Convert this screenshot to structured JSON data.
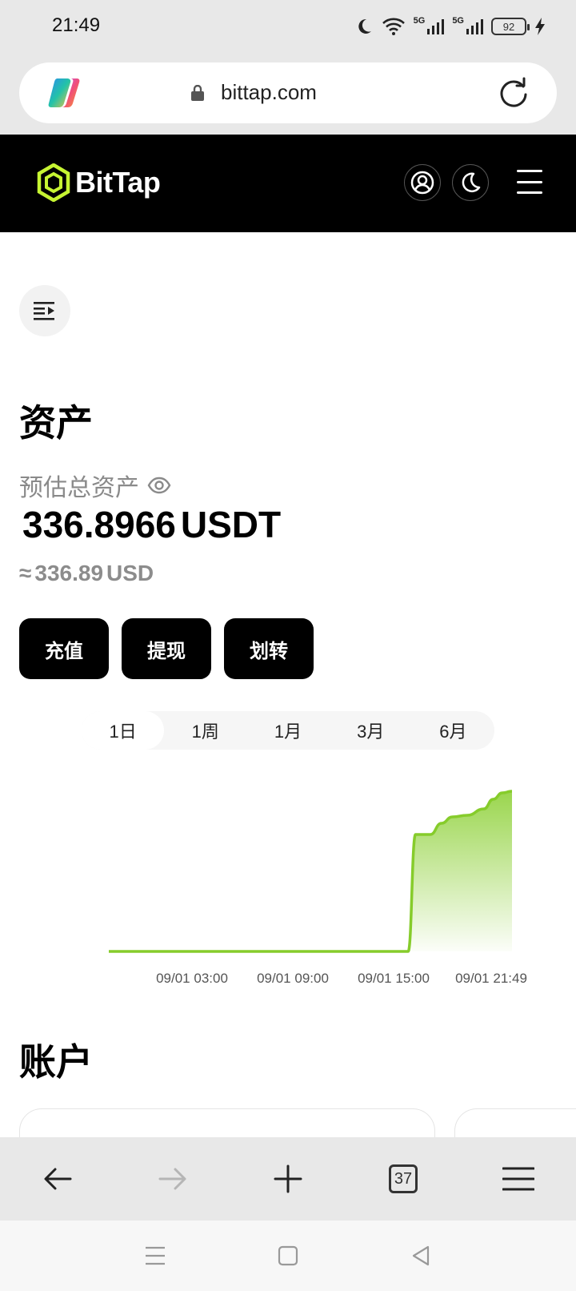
{
  "status_bar": {
    "time": "21:49",
    "battery": "92",
    "network_1": "5G",
    "network_2": "5G"
  },
  "browser": {
    "url": "bittap.com",
    "tab_count": "37"
  },
  "header": {
    "brand_name": "BitTap",
    "brand_color": "#c6f432"
  },
  "assets": {
    "title": "资产",
    "estimated_label": "预估总资产",
    "estimated_amount": "336.8966",
    "estimated_unit": "USDT",
    "approx_symbol": "≈",
    "approx_amount": "336.89",
    "approx_unit": "USD"
  },
  "actions": {
    "deposit": "充值",
    "withdraw": "提现",
    "transfer": "划转"
  },
  "periods": [
    {
      "label": "1日",
      "active": true
    },
    {
      "label": "1周",
      "active": false
    },
    {
      "label": "1月",
      "active": false
    },
    {
      "label": "3月",
      "active": false
    },
    {
      "label": "6月",
      "active": false
    }
  ],
  "chart_data": {
    "type": "area",
    "x_tick_labels": [
      "09/01 03:00",
      "09/01 09:00",
      "09/01 15:00",
      "09/01 21:49"
    ],
    "x_hours": [
      0,
      2,
      4,
      6,
      8,
      10,
      12,
      14,
      15.5,
      16.2,
      16.6,
      17.4,
      18,
      18.6,
      19.4,
      20.3,
      20.8,
      21.3,
      21.82
    ],
    "values": [
      0,
      0,
      0,
      0,
      0,
      0,
      0,
      0,
      0,
      0,
      73,
      73,
      80,
      84,
      85,
      89,
      95,
      99,
      100
    ],
    "ylim": [
      0,
      100
    ],
    "line_color": "#86cc2b",
    "grid": false,
    "legend": "none"
  },
  "account": {
    "title": "账户"
  }
}
